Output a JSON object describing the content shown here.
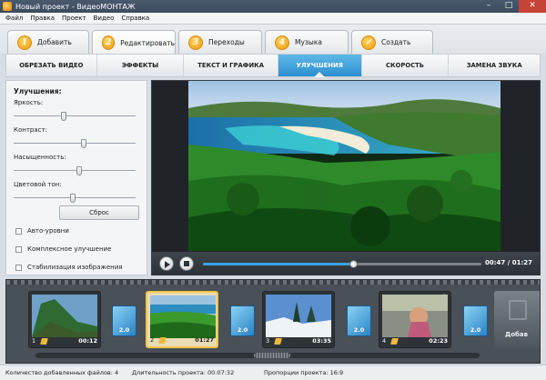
{
  "window": {
    "title": "Новый проект - ВидеоМОНТАЖ",
    "minimize": "–",
    "maximize": "□",
    "close": "✕"
  },
  "menu": [
    "Файл",
    "Правка",
    "Проект",
    "Видео",
    "Справка"
  ],
  "steps": [
    {
      "num": "1",
      "label": "Добавить"
    },
    {
      "num": "2",
      "label": "Редактировать",
      "active": true
    },
    {
      "num": "3",
      "label": "Переходы"
    },
    {
      "num": "4",
      "label": "Музыка"
    },
    {
      "num": "✓",
      "label": "Создать"
    }
  ],
  "subtabs": [
    {
      "label": "ОБРЕЗАТЬ ВИДЕО"
    },
    {
      "label": "ЭФФЕКТЫ"
    },
    {
      "label": "ТЕКСТ И ГРАФИКА"
    },
    {
      "label": "УЛУЧШЕНИЯ",
      "active": true
    },
    {
      "label": "СКОРОСТЬ"
    },
    {
      "label": "ЗАМЕНА ЗВУКА"
    }
  ],
  "enhance": {
    "title": "Улучшения:",
    "sliders": [
      {
        "label": "Яркость:",
        "value": 0.4
      },
      {
        "label": "Контраст:",
        "value": 0.57
      },
      {
        "label": "Насыщенность:",
        "value": 0.53
      },
      {
        "label": "Цветовой тон:",
        "value": 0.48
      }
    ],
    "reset": "Сброс",
    "checks": [
      {
        "label": "Авто-уровни",
        "checked": false
      },
      {
        "label": "Комплексное улучшение",
        "checked": false
      },
      {
        "label": "Стабилизация изображения",
        "checked": false
      }
    ]
  },
  "player": {
    "time": "00:47 / 01:27",
    "progress": 0.54
  },
  "timeline": {
    "clips": [
      {
        "num": "1",
        "duration": "00:12",
        "selected": false,
        "warning": false
      },
      {
        "num": "2",
        "duration": "01:27",
        "selected": true,
        "warning": true
      },
      {
        "num": "3",
        "duration": "03:35",
        "selected": false,
        "warning": false
      },
      {
        "num": "4",
        "duration": "02:23",
        "selected": false,
        "warning": true
      }
    ],
    "transitions": [
      "2.0",
      "2.0",
      "2.0",
      "2.0"
    ],
    "add_label": "Добав"
  },
  "status": {
    "files": "Количество добавленных файлов: 4",
    "duration": "Длительность проекта: 00:07:32",
    "ratio": "Пропорции проекта: 16:9"
  }
}
